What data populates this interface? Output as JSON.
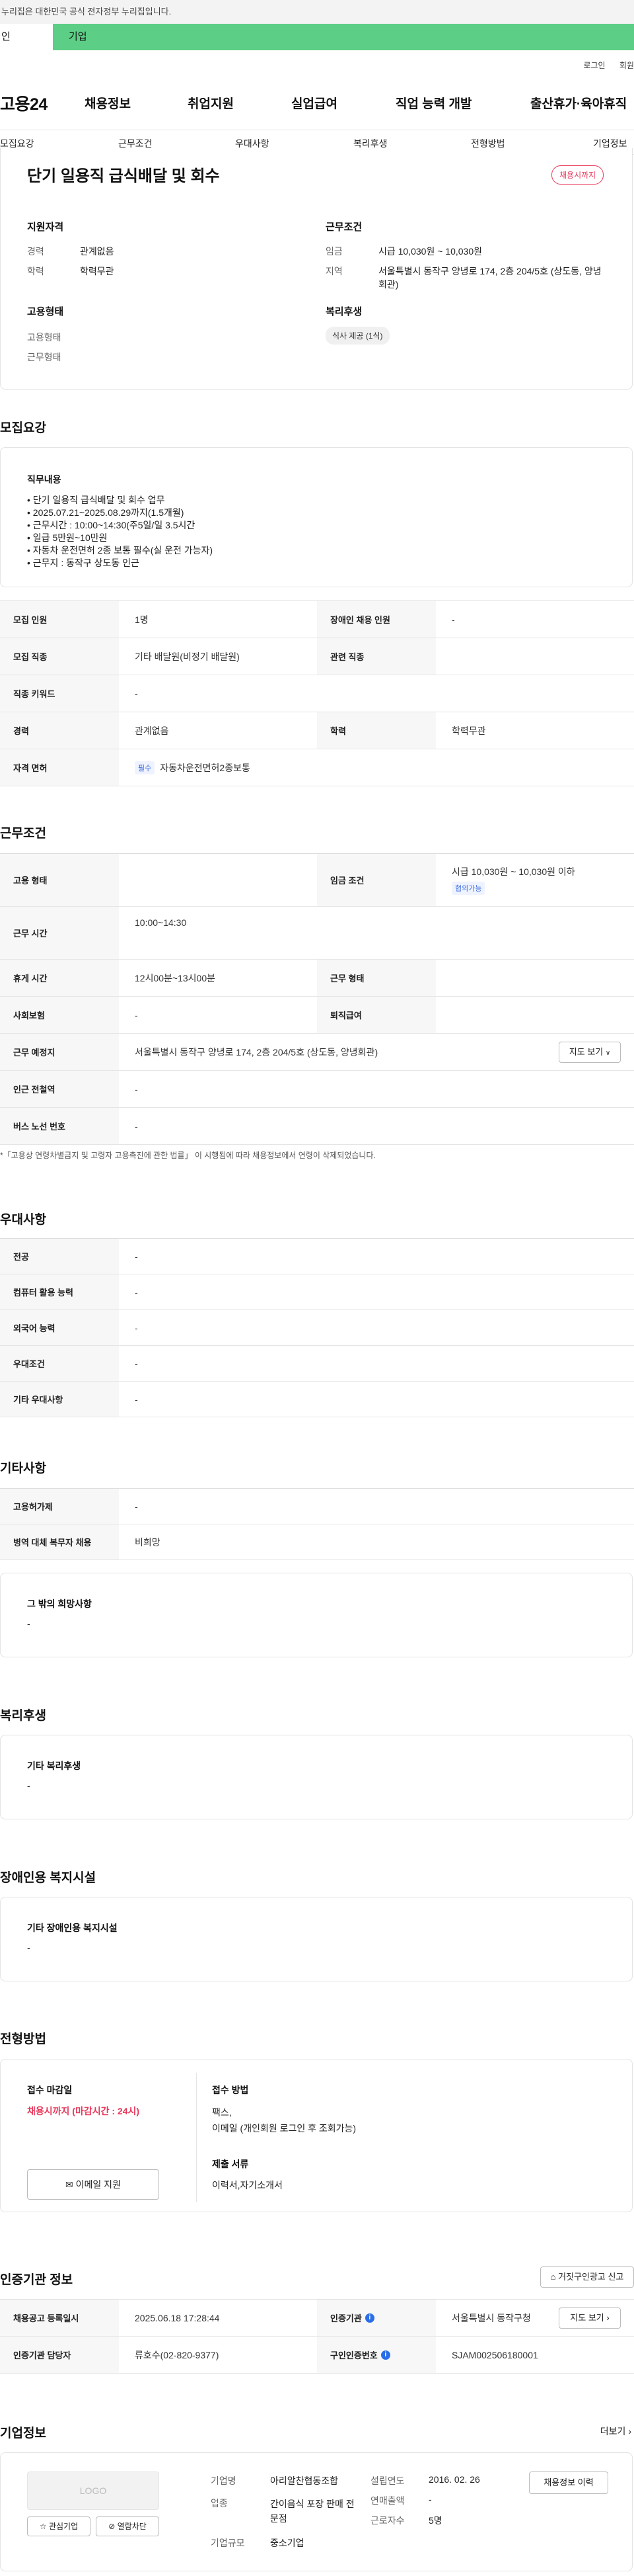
{
  "gov_banner": "이 누리집은 대한민국 공식 전자정부 누리집입니다.",
  "gov_banner_visible": "누리집은 대한민국 공식 전자정부 누리집입니다.",
  "top_tabs": {
    "person": "인",
    "company": "기업"
  },
  "util": {
    "login": "로그인",
    "join": "회원"
  },
  "logo": "고용24",
  "gnb": [
    "채용정보",
    "취업지원",
    "실업급여",
    "직업 능력 개발",
    "출산휴가·육아휴직"
  ],
  "subnav": [
    "모집요강",
    "근무조건",
    "우대사항",
    "복리후생",
    "전형방법",
    "기업정보"
  ],
  "job": {
    "title": "단기 일용직 급식배달 및 회수",
    "status_badge": "채용시까지",
    "applicant_qual_title": "지원자격",
    "career_label": "경력",
    "career_value": "관계없음",
    "edu_label": "학력",
    "edu_value": "학력무관",
    "emp_type_title": "고용형태",
    "emp_type_label": "고용형태",
    "work_type_label": "근무형태",
    "work_cond_title": "근무조건",
    "wage_label": "임금",
    "wage_value": "시급 10,030원 ~ 10,030원",
    "area_label": "지역",
    "area_value": "서울특별시 동작구 양녕로 174, 2층 204/5호 (상도동, 양녕회관)",
    "welfare_title": "복리후생",
    "welfare_chip": "식사 제공 (1식)"
  },
  "recruit": {
    "section_title": "모집요강",
    "duty_title": "직무내용",
    "duty_lines": [
      "• 단기 일용직 급식배달 및 회수 업무",
      "• 2025.07.21~2025.08.29까지(1.5개월)",
      "• 근무시간 : 10:00~14:30(주5일/일 3.5시간",
      "• 일급 5만원~10만원",
      "• 자동차 운전면허 2종 보통 필수(실 운전 가능자)",
      "• 근무지 : 동작구 상도동 인근"
    ],
    "rows": {
      "count_label": "모집 인원",
      "count_value": "1명",
      "disabled_label": "장애인 채용 인원",
      "disabled_value": "-",
      "job_label": "모집 직종",
      "job_value": "기타 배달원(비정기 배달원)",
      "related_label": "관련 직종",
      "related_value": "",
      "keyword_label": "직종 키워드",
      "keyword_value": "-",
      "career_label": "경력",
      "career_value": "관계없음",
      "edu_label": "학력",
      "edu_value": "학력무관",
      "license_label": "자격 면허",
      "license_chip": "필수",
      "license_value": "자동차운전면허2종보통"
    }
  },
  "conditions": {
    "section_title": "근무조건",
    "emp_type_label": "고용 형태",
    "emp_type_value": "",
    "wage_label": "임금 조건",
    "wage_value": "시급 10,030원 ~ 10,030원 이하",
    "wage_chip": "협의가능",
    "hours_label": "근무 시간",
    "hours_value": "10:00~14:30",
    "break_label": "휴게 시간",
    "break_value": "12시00분~13시00분",
    "worktype_label": "근무 형태",
    "worktype_value": "",
    "insurance_label": "사회보험",
    "insurance_value": "-",
    "severance_label": "퇴직급여",
    "severance_value": "",
    "place_label": "근무 예정지",
    "place_value": "서울특별시 동작구 양녕로 174, 2층 204/5호 (상도동, 양녕회관)",
    "map_button": "지도 보기",
    "subway_label": "인근 전철역",
    "subway_value": "-",
    "bus_label": "버스 노선 번호",
    "bus_value": "-",
    "note": "「고용상 연령차별금지 및 고령자 고용촉진에 관한 법률」 이 시행됨에 따라 채용정보에서 연령이 삭제되었습니다."
  },
  "preferences": {
    "section_title": "우대사항",
    "major_label": "전공",
    "major_value": "-",
    "computer_label": "컴퓨터 활용 능력",
    "computer_value": "-",
    "language_label": "외국어 능력",
    "language_value": "-",
    "pref_label": "우대조건",
    "pref_value": "-",
    "etc_label": "기타 우대사항",
    "etc_value": "-"
  },
  "etc": {
    "section_title": "기타사항",
    "permit_label": "고용허가제",
    "permit_value": "-",
    "military_label": "병역 대체 복무자 채용",
    "military_value": "비희망",
    "wish_title": "그 밖의 희망사항",
    "wish_value": "-"
  },
  "welfare": {
    "section_title": "복리후생",
    "card_title": "기타 복리후생",
    "card_value": "-"
  },
  "disabled_facility": {
    "section_title": "장애인용 복지시설",
    "card_title": "기타 장애인용 복지시설",
    "card_value": "-"
  },
  "screening": {
    "section_title": "전형방법",
    "deadline_title": "접수 마감일",
    "deadline_value": "채용시까지 (마감시간 : 24시)",
    "email_button": "이메일 지원",
    "method_title": "접수 방법",
    "method_lines": [
      "팩스,",
      "이메일 (개인회원 로그인 후 조회가능)"
    ],
    "docs_title": "제출 서류",
    "docs_value": "이력서,자기소개서"
  },
  "agency": {
    "section_title": "인증기관 정보",
    "report_button": "거짓구인광고 신고",
    "reg_label": "채용공고 등록일시",
    "reg_value": "2025.06.18 17:28:44",
    "agency_label": "인증기관",
    "agency_value": "서울특별시 동작구청",
    "map_button": "지도 보기",
    "manager_label": "인증기관 담당자",
    "manager_value": "류호수(02-820-9377)",
    "jobno_label": "구인인증번호",
    "jobno_value": "SJAM002506180001"
  },
  "company": {
    "section_title": "기업정보",
    "more": "더보기",
    "logo_text": "LOGO",
    "fav_button": "관심기업",
    "block_button": "열람차단",
    "name_label": "기업명",
    "name_value": "아리알찬협동조합",
    "industry_label": "업종",
    "industry_value": "간이음식 포장 판매 전문점",
    "size_label": "기업규모",
    "size_value": "중소기업",
    "founded_label": "설립연도",
    "founded_value": "2016. 02. 26",
    "sales_label": "연매출액",
    "sales_value": "-",
    "employees_label": "근로자수",
    "employees_value": "5명",
    "history_button": "채용정보 이력"
  }
}
